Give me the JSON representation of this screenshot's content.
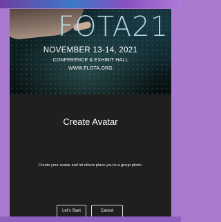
{
  "banner": {
    "logo_text": "FOTA21",
    "event_date": "NOVEMBER 13-14, 2021",
    "venue": "CONFERENCE & EXHIBIT HALL",
    "website": "WWW.FLOTA.ORG"
  },
  "dialog": {
    "title": "Create Avatar",
    "description": "Create your avatar and let others place you in a group photo.",
    "start_label": "Let's Start",
    "cancel_label": "Cancel"
  },
  "colors": {
    "frame_background": "#a97ad0",
    "screen_background": "#1f1f1f",
    "text": "#ffffff",
    "button_border": "#d8d8d8"
  }
}
